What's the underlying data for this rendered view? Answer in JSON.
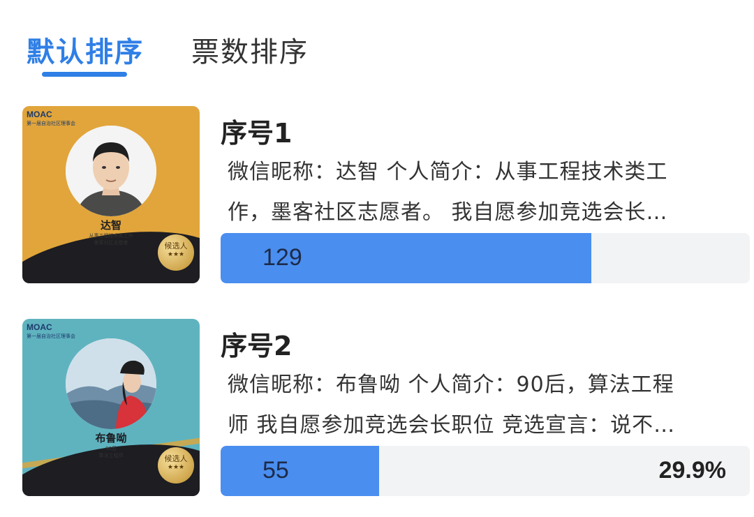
{
  "tabs": {
    "default_sort": "默认排序",
    "vote_sort": "票数排序"
  },
  "candidates": [
    {
      "number_label": "序号1",
      "desc_line1": "微信昵称：达智 个人简介：从事工程技术类工",
      "desc_line2": "作，墨客社区志愿者。 我自愿参加竞选会长…",
      "votes": "129",
      "vote_fraction": 0.7,
      "percent": "",
      "poster": {
        "brand": "MOAC",
        "org": "第一届自治社区理事会",
        "name": "达智",
        "desc1": "从事工程技术类工作",
        "desc2": "墨客社区志愿者",
        "seal": "候选人",
        "seal_stars": "★★★",
        "bg_color": "#e1a53b"
      }
    },
    {
      "number_label": "序号2",
      "desc_line1": "微信昵称：布鲁呦 个人简介：90后，算法工程",
      "desc_line2": "师 我自愿参加竞选会长职位 竞选宣言：说不…",
      "votes": "55",
      "vote_fraction": 0.299,
      "percent": "29.9%",
      "poster": {
        "brand": "MOAC",
        "org": "第一届自治社区理事会",
        "name": "布鲁呦",
        "desc1": "90后",
        "desc2": "算法工程师",
        "seal": "候选人",
        "seal_stars": "★★★",
        "bg_color": "#5fb3bf"
      }
    }
  ]
}
